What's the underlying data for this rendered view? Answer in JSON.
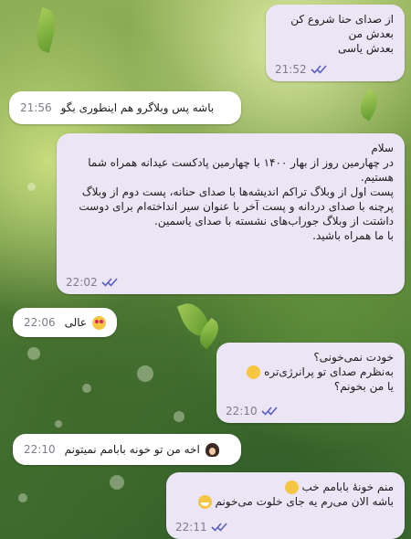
{
  "accent_color": "#5a5fc8",
  "messages": [
    {
      "id": "m1",
      "type": "sent",
      "text": "از صدای حنا شروع کن\nبعدش من\nبعدش یاسی",
      "time": "21:52",
      "status": "read"
    },
    {
      "id": "m2",
      "type": "received",
      "text": "باشه پس وبلاگرو هم اینطوری بگو",
      "time": "21:56"
    },
    {
      "id": "m3",
      "type": "sent",
      "text": "سلام\nدر چهارمین روز از بهار ۱۴۰۰ با چهارمین پادکست عیدانه همراه شما هستیم.\nپست اول از وبلاگ تراکم اندیشه‌ها با صدای حنانه، پست دوم از وبلاگ پرچنه با صدای دردانه و پست آخر با عنوان سیر انداخته‌ام برای دوست داشتت از وبلاگ جوراب‌های نشسته با صدای یاسمین.\nبا ما همراه باشید.",
      "time": "22:02",
      "status": "read"
    },
    {
      "id": "m4",
      "type": "received",
      "text": "عالی",
      "emoji": "love-eyes-emoji",
      "time": "22:06"
    },
    {
      "id": "m5",
      "type": "sent",
      "lines": [
        "خودت نمی‌خونی؟",
        "به‌نظرم صدای تو پرانرژی‌تره",
        "یا من بخونم؟"
      ],
      "emoji": "thinking-emoji",
      "time": "22:10",
      "status": "read"
    },
    {
      "id": "m6",
      "type": "received",
      "text": "اخه من تو خونه بابامم نمیتونم",
      "emoji": "woman-gesturing-emoji",
      "time": "22:10"
    },
    {
      "id": "m7",
      "type": "sent",
      "lines": [
        "منم خونهٔ بابامم خب",
        "باشه الان می‌رم یه جای خلوت می‌خونم"
      ],
      "emoji": "grin-emoji",
      "time": "22:11",
      "status": "read"
    }
  ]
}
